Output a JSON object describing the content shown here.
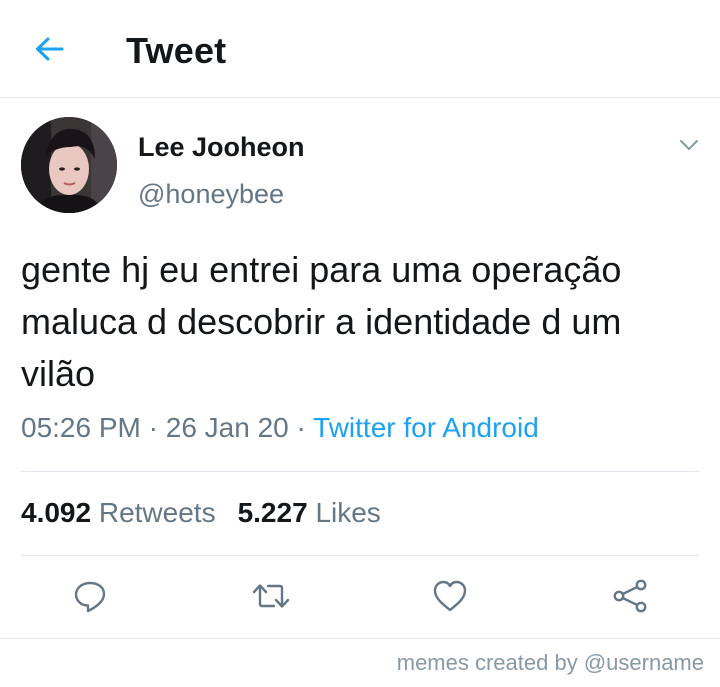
{
  "header": {
    "title": "Tweet",
    "back_icon": "arrow-left-icon"
  },
  "colors": {
    "accent": "#1da1f2",
    "secondary_text": "#657786",
    "primary_text": "#14171a",
    "divider": "#e1e8ed"
  },
  "tweet": {
    "author_name": "Lee Jooheon",
    "author_handle": "@honeybee",
    "text": "gente hj eu entrei para uma operação maluca d descobrir a identidade d um vilão",
    "time": "05:26 PM",
    "separator": "·",
    "date": "26 Jan 20",
    "source": "Twitter for Android"
  },
  "stats": {
    "retweets_count": "4.092",
    "retweets_label": "Retweets",
    "likes_count": "5.227",
    "likes_label": "Likes"
  },
  "actions": [
    "reply-icon",
    "retweet-icon",
    "heart-icon",
    "share-icon"
  ],
  "footer": {
    "credit": "memes created by @username"
  }
}
